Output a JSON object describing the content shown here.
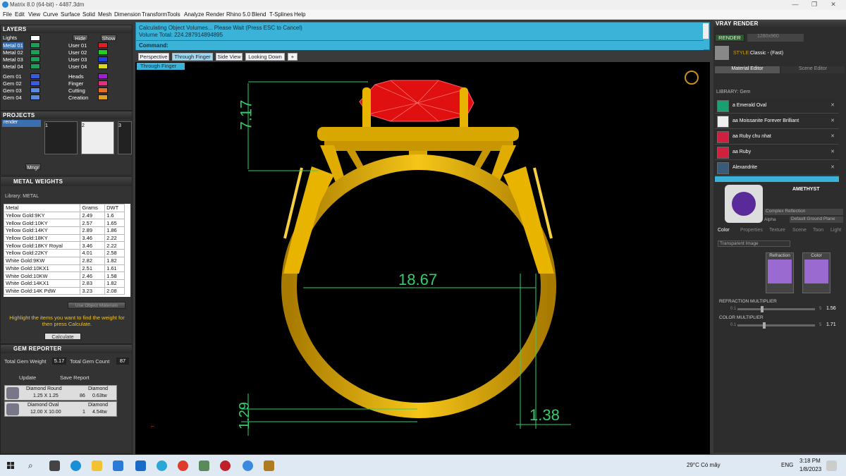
{
  "window": {
    "title": "Matrix 8.0 (64-bit) - 4487.3dm",
    "min": "—",
    "max": "❐",
    "close": "✕"
  },
  "menu": [
    "File",
    "Edit",
    "View",
    "Curve",
    "Surface",
    "Solid",
    "Mesh",
    "Dimension",
    "Transform",
    "Tools",
    "Analyze",
    "Render",
    "Rhino 5.0",
    "Blend",
    "T-Splines",
    "Help"
  ],
  "layers": {
    "title": "LAYERS",
    "left": [
      "Lights",
      "Metal 01",
      "Metal 02",
      "Metal 03",
      "Metal 04",
      "Gem 01",
      "Gem 02",
      "Gem 03",
      "Gem 04"
    ],
    "right": [
      "User 01",
      "User 02",
      "User 03",
      "User 04",
      "Heads",
      "Finger",
      "Cutting",
      "Creation"
    ],
    "hide": "Hide",
    "show": "Show"
  },
  "projects": {
    "title": "PROJECTS",
    "item": "render",
    "nums": [
      "1",
      "2",
      "3"
    ],
    "button": "Mngr"
  },
  "metal_weights": {
    "title": "METAL WEIGHTS",
    "library": "Library: METAL",
    "headers": [
      "Metal",
      "Grams",
      "DWT"
    ],
    "rows": [
      [
        "Yellow Gold:9KY",
        "2.49",
        "1.6"
      ],
      [
        "Yellow Gold:10KY",
        "2.57",
        "1.65"
      ],
      [
        "Yellow Gold:14KY",
        "2.89",
        "1.86"
      ],
      [
        "Yellow Gold:18KY",
        "3.46",
        "2.22"
      ],
      [
        "Yellow Gold:18KY Royal",
        "3.46",
        "2.22"
      ],
      [
        "Yellow Gold:22KY",
        "4.01",
        "2.58"
      ],
      [
        "White Gold:9KW",
        "2.82",
        "1.82"
      ],
      [
        "White Gold:10KX1",
        "2.51",
        "1.61"
      ],
      [
        "White Gold:10KW",
        "2.46",
        "1.58"
      ],
      [
        "White Gold:14KX1",
        "2.83",
        "1.82"
      ],
      [
        "White Gold:14K PdW",
        "3.23",
        "2.08"
      ]
    ],
    "use_obj": "Use Object Materials",
    "hint": "Highlight the items you want to find the weight for then press Calculate.",
    "calc": "Calculate"
  },
  "gem_reporter": {
    "title": "GEM REPORTER",
    "tw_label": "Total Gem Weight",
    "tw": "5.17",
    "tc_label": "Total Gem Count",
    "tc": "87",
    "update": "Update",
    "save": "Save Report",
    "gems": [
      {
        "name": "Diamond Round",
        "size": "1.25 X 1.25",
        "type": "Diamond",
        "count": "86",
        "ctw": "0.63tw"
      },
      {
        "name": "Diamond Oval",
        "size": "12.00 X 10.00",
        "type": "Diamond",
        "count": "1",
        "ctw": "4.54tw"
      }
    ]
  },
  "command": {
    "line1": "Calculating Object Volumes... Please Wait (Press ESC to Cancel)",
    "line2": "Volume Total: 224.287914894895",
    "prompt": "Command:"
  },
  "tabs": [
    "Perspective",
    "Through Finger",
    "Side View",
    "Looking Down",
    "+"
  ],
  "viewport_label": "Through Finger",
  "dims": {
    "top": "7.17",
    "width": "18.67",
    "bottom": "1.29",
    "band": "1.38"
  },
  "vray": {
    "title": "VRAY RENDER",
    "render": "RENDER",
    "res": "1280x960",
    "style_label": "STYLE:",
    "style": "Classic - (Fast)"
  },
  "editor": {
    "tab1": "Material Editor",
    "tab2": "Scene Editor",
    "library": "LIBRARY: Gem",
    "materials": [
      "a Emerald Oval",
      "aa Moissanite Forever Brilliant",
      "aa Ruby chu nhat",
      "aa Ruby",
      "Alexandrite"
    ],
    "selected": "AMETHYST",
    "complex": "Complex Reflection",
    "alpha": "Alpha",
    "ground": "Default Ground Plane",
    "subtabs": [
      "Color",
      "Properties",
      "Texture",
      "Scene",
      "Toon",
      "Light"
    ],
    "transparent": "Transparent Image",
    "refraction": "Refraction",
    "color": "Color",
    "refr_mult_label": "REFRACTION MULTIPLIER",
    "refr_min": "0.1",
    "refr_max": "5",
    "refr_val": "1.56",
    "color_mult_label": "COLOR MULTIPLIER",
    "color_min": "0.1",
    "color_max": "5",
    "color_val": "1.71"
  },
  "taskbar": {
    "weather": "29°C Có mây",
    "lang": "ENG",
    "time": "3:18 PM",
    "date": "1/8/2023"
  }
}
